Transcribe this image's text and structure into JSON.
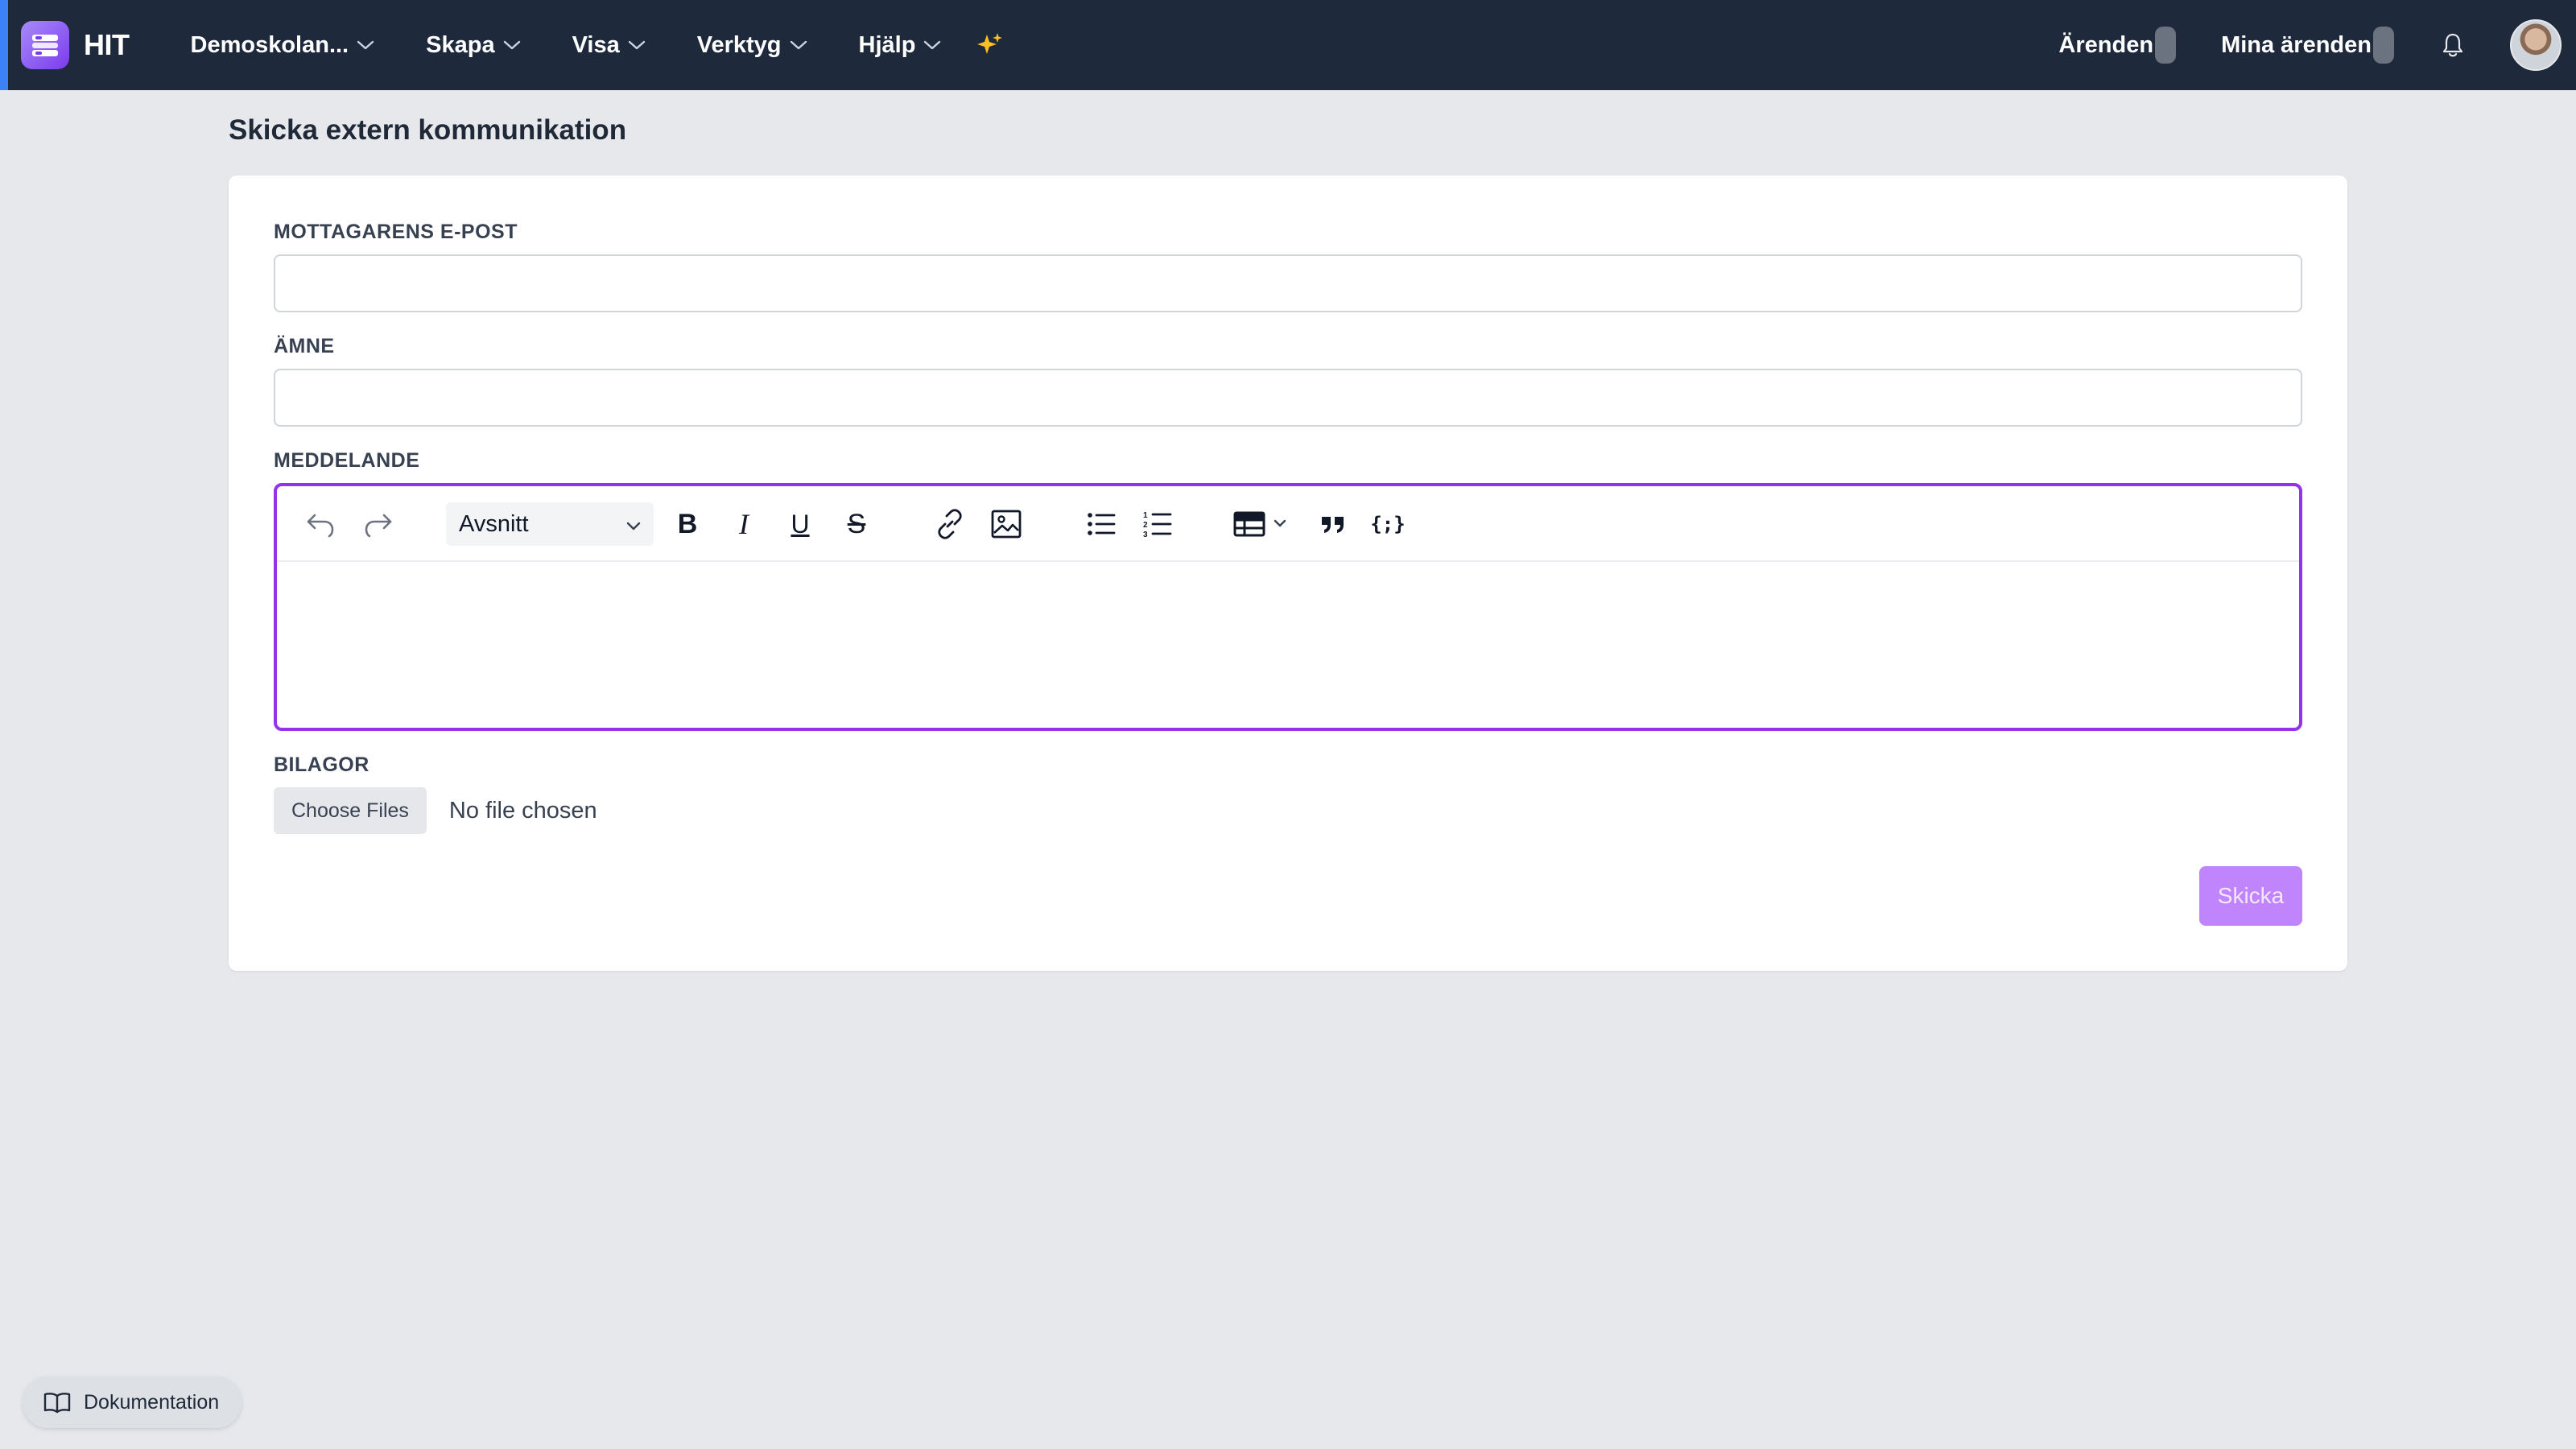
{
  "app": {
    "name": "HIT",
    "brand_color": "#7c3aed",
    "nav_bg": "#1e293b",
    "accent": "#9333ea"
  },
  "nav": {
    "items": [
      {
        "label": "Demoskolan...",
        "icon": "chevron-down-icon"
      },
      {
        "label": "Skapa",
        "icon": "chevron-down-icon"
      },
      {
        "label": "Visa",
        "icon": "chevron-down-icon"
      },
      {
        "label": "Verktyg",
        "icon": "chevron-down-icon"
      },
      {
        "label": "Hjälp",
        "icon": "chevron-down-icon"
      }
    ],
    "ai_icon": "sparkle-icon",
    "right": {
      "cases_label": "Ärenden",
      "my_cases_label": "Mina ärenden",
      "bell_icon": "bell-icon",
      "avatar": "user-avatar"
    }
  },
  "page": {
    "title": "Skicka extern kommunikation"
  },
  "form": {
    "recipient_label": "MOTTAGARENS E-POST",
    "recipient_value": "",
    "subject_label": "ÄMNE",
    "subject_value": "",
    "message_label": "MEDDELANDE",
    "editor": {
      "block_format": "Avsnitt",
      "tools": [
        "undo-icon",
        "redo-icon",
        "bold-icon",
        "italic-icon",
        "underline-icon",
        "strikethrough-icon",
        "link-icon",
        "image-icon",
        "bullet-list-icon",
        "numbered-list-icon",
        "table-icon",
        "quote-icon",
        "code-braces-icon"
      ],
      "bold_glyph": "B",
      "italic_glyph": "I",
      "underline_glyph": "U",
      "strike_glyph": "S",
      "code_glyph": "{;}"
    },
    "attachments_label": "BILAGOR",
    "choose_files_label": "Choose Files",
    "file_status": "No file chosen",
    "send_label": "Skicka"
  },
  "footer": {
    "docs_label": "Dokumentation",
    "docs_icon": "book-icon"
  }
}
